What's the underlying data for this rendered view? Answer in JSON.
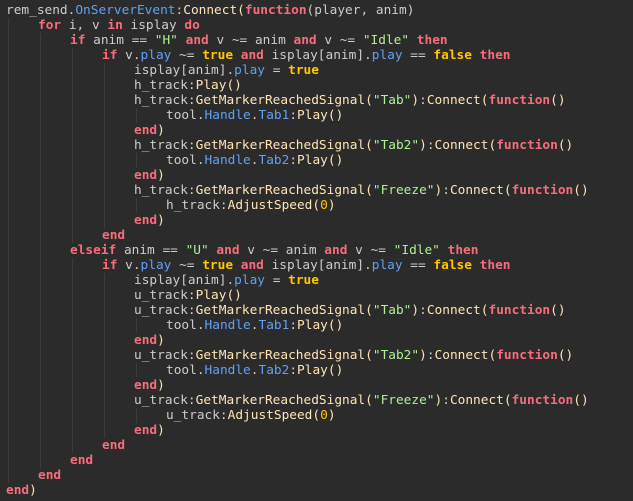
{
  "colors": {
    "background": "#2b2b2b",
    "text": "#cccccc",
    "keyword": "#f86d7c",
    "string": "#adf195",
    "number": "#ffc600",
    "method": "#ffe4b5",
    "property": "#61a1f1",
    "guide": "#3c3c3c"
  },
  "code_lines": [
    {
      "indent": 0,
      "tokens": [
        [
          "rem_send.",
          "plain"
        ],
        [
          "OnServerEvent",
          "prop"
        ],
        [
          ":",
          "plain"
        ],
        [
          "Connect",
          "method"
        ],
        [
          "(",
          "paren"
        ],
        [
          "function",
          "kw"
        ],
        [
          "(player, anim)",
          "plain"
        ]
      ]
    },
    {
      "indent": 1,
      "tokens": [
        [
          "for",
          "kw"
        ],
        [
          " i, v ",
          "plain"
        ],
        [
          "in",
          "kw"
        ],
        [
          " isplay ",
          "plain"
        ],
        [
          "do",
          "kw"
        ]
      ]
    },
    {
      "indent": 2,
      "tokens": [
        [
          "if",
          "kw"
        ],
        [
          " anim == ",
          "plain"
        ],
        [
          "\"H\"",
          "str"
        ],
        [
          " ",
          "plain"
        ],
        [
          "and",
          "kw"
        ],
        [
          " v ~= anim ",
          "plain"
        ],
        [
          "and",
          "kw"
        ],
        [
          " v ~= ",
          "plain"
        ],
        [
          "\"Idle\"",
          "str"
        ],
        [
          " ",
          "plain"
        ],
        [
          "then",
          "kw"
        ]
      ]
    },
    {
      "indent": 3,
      "tokens": [
        [
          "if",
          "kw"
        ],
        [
          " v.",
          "plain"
        ],
        [
          "play",
          "prop"
        ],
        [
          " ~= ",
          "plain"
        ],
        [
          "true",
          "bool"
        ],
        [
          " ",
          "plain"
        ],
        [
          "and",
          "kw"
        ],
        [
          " isplay[anim].",
          "plain"
        ],
        [
          "play",
          "prop"
        ],
        [
          " == ",
          "plain"
        ],
        [
          "false",
          "bool"
        ],
        [
          " ",
          "plain"
        ],
        [
          "then",
          "kw"
        ]
      ]
    },
    {
      "indent": 4,
      "tokens": [
        [
          "isplay[anim].",
          "plain"
        ],
        [
          "play",
          "prop"
        ],
        [
          " = ",
          "plain"
        ],
        [
          "true",
          "bool"
        ]
      ]
    },
    {
      "indent": 4,
      "tokens": [
        [
          "h_track:",
          "plain"
        ],
        [
          "Play",
          "method"
        ],
        [
          "()",
          "paren"
        ]
      ]
    },
    {
      "indent": 4,
      "tokens": [
        [
          "h_track:",
          "plain"
        ],
        [
          "GetMarkerReachedSignal",
          "method"
        ],
        [
          "(",
          "paren"
        ],
        [
          "\"Tab\"",
          "str"
        ],
        [
          ")",
          "paren"
        ],
        [
          ":",
          "plain"
        ],
        [
          "Connect",
          "method"
        ],
        [
          "(",
          "paren"
        ],
        [
          "function",
          "kw"
        ],
        [
          "()",
          "paren"
        ]
      ]
    },
    {
      "indent": 5,
      "tokens": [
        [
          "tool.",
          "plain"
        ],
        [
          "Handle",
          "prop"
        ],
        [
          ".",
          "plain"
        ],
        [
          "Tab1",
          "prop"
        ],
        [
          ":",
          "plain"
        ],
        [
          "Play",
          "method"
        ],
        [
          "()",
          "paren"
        ]
      ]
    },
    {
      "indent": 4,
      "tokens": [
        [
          "end",
          "kw"
        ],
        [
          ")",
          "paren"
        ]
      ]
    },
    {
      "indent": 4,
      "tokens": [
        [
          "h_track:",
          "plain"
        ],
        [
          "GetMarkerReachedSignal",
          "method"
        ],
        [
          "(",
          "paren"
        ],
        [
          "\"Tab2\"",
          "str"
        ],
        [
          ")",
          "paren"
        ],
        [
          ":",
          "plain"
        ],
        [
          "Connect",
          "method"
        ],
        [
          "(",
          "paren"
        ],
        [
          "function",
          "kw"
        ],
        [
          "()",
          "paren"
        ]
      ]
    },
    {
      "indent": 5,
      "tokens": [
        [
          "tool.",
          "plain"
        ],
        [
          "Handle",
          "prop"
        ],
        [
          ".",
          "plain"
        ],
        [
          "Tab2",
          "prop"
        ],
        [
          ":",
          "plain"
        ],
        [
          "Play",
          "method"
        ],
        [
          "()",
          "paren"
        ]
      ]
    },
    {
      "indent": 4,
      "tokens": [
        [
          "end",
          "kw"
        ],
        [
          ")",
          "paren"
        ]
      ]
    },
    {
      "indent": 4,
      "tokens": [
        [
          "h_track:",
          "plain"
        ],
        [
          "GetMarkerReachedSignal",
          "method"
        ],
        [
          "(",
          "paren"
        ],
        [
          "\"Freeze\"",
          "str"
        ],
        [
          ")",
          "paren"
        ],
        [
          ":",
          "plain"
        ],
        [
          "Connect",
          "method"
        ],
        [
          "(",
          "paren"
        ],
        [
          "function",
          "kw"
        ],
        [
          "()",
          "paren"
        ]
      ]
    },
    {
      "indent": 5,
      "tokens": [
        [
          "h_track:",
          "plain"
        ],
        [
          "AdjustSpeed",
          "method"
        ],
        [
          "(",
          "paren"
        ],
        [
          "0",
          "num"
        ],
        [
          ")",
          "paren"
        ]
      ]
    },
    {
      "indent": 4,
      "tokens": [
        [
          "end",
          "kw"
        ],
        [
          ")",
          "paren"
        ]
      ]
    },
    {
      "indent": 3,
      "tokens": [
        [
          "end",
          "kw"
        ]
      ]
    },
    {
      "indent": 2,
      "tokens": [
        [
          "elseif",
          "kw"
        ],
        [
          " anim == ",
          "plain"
        ],
        [
          "\"U\"",
          "str"
        ],
        [
          " ",
          "plain"
        ],
        [
          "and",
          "kw"
        ],
        [
          " v ~= anim ",
          "plain"
        ],
        [
          "and",
          "kw"
        ],
        [
          " v ~= ",
          "plain"
        ],
        [
          "\"Idle\"",
          "str"
        ],
        [
          " ",
          "plain"
        ],
        [
          "then",
          "kw"
        ]
      ]
    },
    {
      "indent": 3,
      "tokens": [
        [
          "if",
          "kw"
        ],
        [
          " v.",
          "plain"
        ],
        [
          "play",
          "prop"
        ],
        [
          " ~= ",
          "plain"
        ],
        [
          "true",
          "bool"
        ],
        [
          " ",
          "plain"
        ],
        [
          "and",
          "kw"
        ],
        [
          " isplay[anim].",
          "plain"
        ],
        [
          "play",
          "prop"
        ],
        [
          " == ",
          "plain"
        ],
        [
          "false",
          "bool"
        ],
        [
          " ",
          "plain"
        ],
        [
          "then",
          "kw"
        ]
      ]
    },
    {
      "indent": 4,
      "tokens": [
        [
          "isplay[anim].",
          "plain"
        ],
        [
          "play",
          "prop"
        ],
        [
          " = ",
          "plain"
        ],
        [
          "true",
          "bool"
        ]
      ]
    },
    {
      "indent": 4,
      "tokens": [
        [
          "u_track:",
          "plain"
        ],
        [
          "Play",
          "method"
        ],
        [
          "()",
          "paren"
        ]
      ]
    },
    {
      "indent": 4,
      "tokens": [
        [
          "u_track:",
          "plain"
        ],
        [
          "GetMarkerReachedSignal",
          "method"
        ],
        [
          "(",
          "paren"
        ],
        [
          "\"Tab\"",
          "str"
        ],
        [
          ")",
          "paren"
        ],
        [
          ":",
          "plain"
        ],
        [
          "Connect",
          "method"
        ],
        [
          "(",
          "paren"
        ],
        [
          "function",
          "kw"
        ],
        [
          "()",
          "paren"
        ]
      ]
    },
    {
      "indent": 5,
      "tokens": [
        [
          "tool.",
          "plain"
        ],
        [
          "Handle",
          "prop"
        ],
        [
          ".",
          "plain"
        ],
        [
          "Tab1",
          "prop"
        ],
        [
          ":",
          "plain"
        ],
        [
          "Play",
          "method"
        ],
        [
          "()",
          "paren"
        ]
      ]
    },
    {
      "indent": 4,
      "tokens": [
        [
          "end",
          "kw"
        ],
        [
          ")",
          "paren"
        ]
      ]
    },
    {
      "indent": 4,
      "tokens": [
        [
          "u_track:",
          "plain"
        ],
        [
          "GetMarkerReachedSignal",
          "method"
        ],
        [
          "(",
          "paren"
        ],
        [
          "\"Tab2\"",
          "str"
        ],
        [
          ")",
          "paren"
        ],
        [
          ":",
          "plain"
        ],
        [
          "Connect",
          "method"
        ],
        [
          "(",
          "paren"
        ],
        [
          "function",
          "kw"
        ],
        [
          "()",
          "paren"
        ]
      ]
    },
    {
      "indent": 5,
      "tokens": [
        [
          "tool.",
          "plain"
        ],
        [
          "Handle",
          "prop"
        ],
        [
          ".",
          "plain"
        ],
        [
          "Tab2",
          "prop"
        ],
        [
          ":",
          "plain"
        ],
        [
          "Play",
          "method"
        ],
        [
          "()",
          "paren"
        ]
      ]
    },
    {
      "indent": 4,
      "tokens": [
        [
          "end",
          "kw"
        ],
        [
          ")",
          "paren"
        ]
      ]
    },
    {
      "indent": 4,
      "tokens": [
        [
          "u_track:",
          "plain"
        ],
        [
          "GetMarkerReachedSignal",
          "method"
        ],
        [
          "(",
          "paren"
        ],
        [
          "\"Freeze\"",
          "str"
        ],
        [
          ")",
          "paren"
        ],
        [
          ":",
          "plain"
        ],
        [
          "Connect",
          "method"
        ],
        [
          "(",
          "paren"
        ],
        [
          "function",
          "kw"
        ],
        [
          "()",
          "paren"
        ]
      ]
    },
    {
      "indent": 5,
      "tokens": [
        [
          "u_track:",
          "plain"
        ],
        [
          "AdjustSpeed",
          "method"
        ],
        [
          "(",
          "paren"
        ],
        [
          "0",
          "num"
        ],
        [
          ")",
          "paren"
        ]
      ]
    },
    {
      "indent": 4,
      "tokens": [
        [
          "end",
          "kw"
        ],
        [
          ")",
          "paren"
        ]
      ]
    },
    {
      "indent": 3,
      "tokens": [
        [
          "end",
          "kw"
        ]
      ]
    },
    {
      "indent": 2,
      "tokens": [
        [
          "end",
          "kw"
        ]
      ]
    },
    {
      "indent": 1,
      "tokens": [
        [
          "end",
          "kw"
        ]
      ]
    },
    {
      "indent": 0,
      "tokens": [
        [
          "end",
          "kw"
        ],
        [
          ")",
          "paren"
        ]
      ]
    }
  ]
}
